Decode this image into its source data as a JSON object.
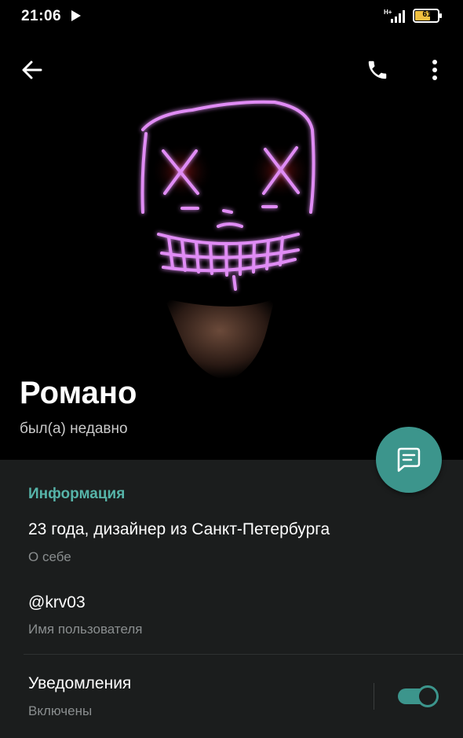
{
  "status_bar": {
    "time": "21:06",
    "network": "H+",
    "battery": "61",
    "icons": [
      "play-icon",
      "signal-icon",
      "battery-icon"
    ]
  },
  "toolbar": {
    "back_icon": "arrow-left-icon",
    "call_icon": "phone-icon",
    "menu_icon": "more-vertical-icon"
  },
  "profile": {
    "name": "Романо",
    "status": "был(а) недавно"
  },
  "fab_icon": "message-icon",
  "info": {
    "title": "Информация",
    "rows": [
      {
        "value": "23 года, дизайнер из Санкт-Петербурга",
        "label": "О себе"
      },
      {
        "value": "@krv03",
        "label": "Имя пользователя"
      }
    ]
  },
  "notifications": {
    "title": "Уведомления",
    "state": "Включены",
    "enabled": true
  },
  "colors": {
    "accent": "#3c958c",
    "accent_text": "#56b3a8",
    "panel_bg": "#1b1d1d"
  }
}
